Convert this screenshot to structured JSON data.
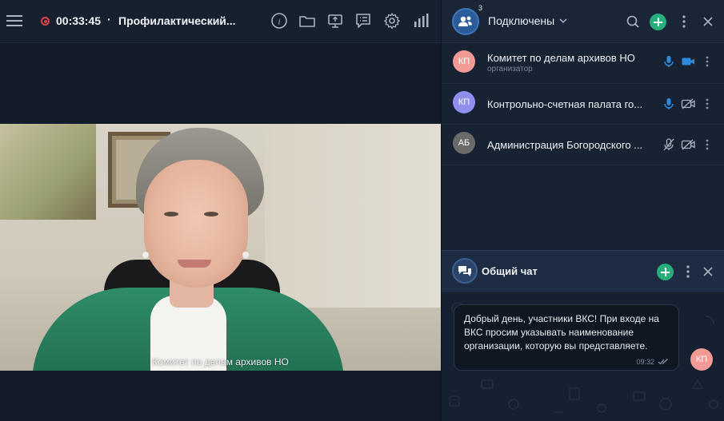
{
  "topbar": {
    "timer": "00:33:45",
    "separator": "·",
    "title": "Профилактический...",
    "icons": [
      "info-icon",
      "folder-icon",
      "screen-share-icon",
      "checklist-icon",
      "settings-icon",
      "stats-icon"
    ]
  },
  "video": {
    "speaker_label": "Комитет по делам архивов НО"
  },
  "participants_panel": {
    "count": "3",
    "header_label": "Подключены",
    "items": [
      {
        "initials": "КП",
        "name": "Комитет по делам архивов НО",
        "role": "организатор",
        "avatar_color": "#f19a96",
        "mic": "on",
        "camera": "on"
      },
      {
        "initials": "КП",
        "name": "Контрольно-счетная палата го...",
        "role": "",
        "avatar_color": "#8f8ff0",
        "mic": "on",
        "camera": "off"
      },
      {
        "initials": "АБ",
        "name": "Администрация Богородского ...",
        "role": "",
        "avatar_color": "#6a6a6a",
        "mic": "off",
        "camera": "off"
      }
    ]
  },
  "chat": {
    "title": "Общий чат",
    "messages": [
      {
        "text": "Добрый день, участники ВКС! При входе на ВКС просим указывать наименование организации, которую вы представляете.",
        "time": "09:32",
        "author_initials": "КП",
        "read": true
      }
    ]
  },
  "colors": {
    "accent_green": "#27ae7a",
    "accent_blue": "#2a8bdf",
    "record_red": "#e0404a"
  }
}
